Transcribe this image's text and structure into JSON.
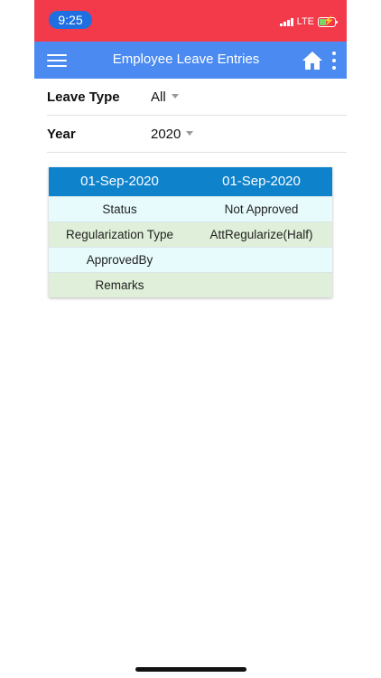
{
  "status_bar": {
    "time": "9:25",
    "network": "LTE",
    "accent_color": "#f23a4b",
    "time_pill_color": "#1f6fe0"
  },
  "app_bar": {
    "title": "Employee Leave Entries",
    "color": "#4b8af0",
    "icons": [
      "hamburger-menu-icon",
      "home-icon",
      "more-vertical-icon"
    ]
  },
  "filters": {
    "leave_type": {
      "label": "Leave Type",
      "value": "All"
    },
    "year": {
      "label": "Year",
      "value": "2020"
    }
  },
  "entry_card": {
    "header_color": "#0f82cc",
    "header": [
      "01-Sep-2020",
      "01-Sep-2020"
    ],
    "rows": [
      {
        "label": "Status",
        "value": "Not Approved"
      },
      {
        "label": "Regularization Type",
        "value": "AttRegularize(Half)"
      },
      {
        "label": "ApprovedBy",
        "value": ""
      },
      {
        "label": "Remarks",
        "value": ""
      }
    ]
  }
}
